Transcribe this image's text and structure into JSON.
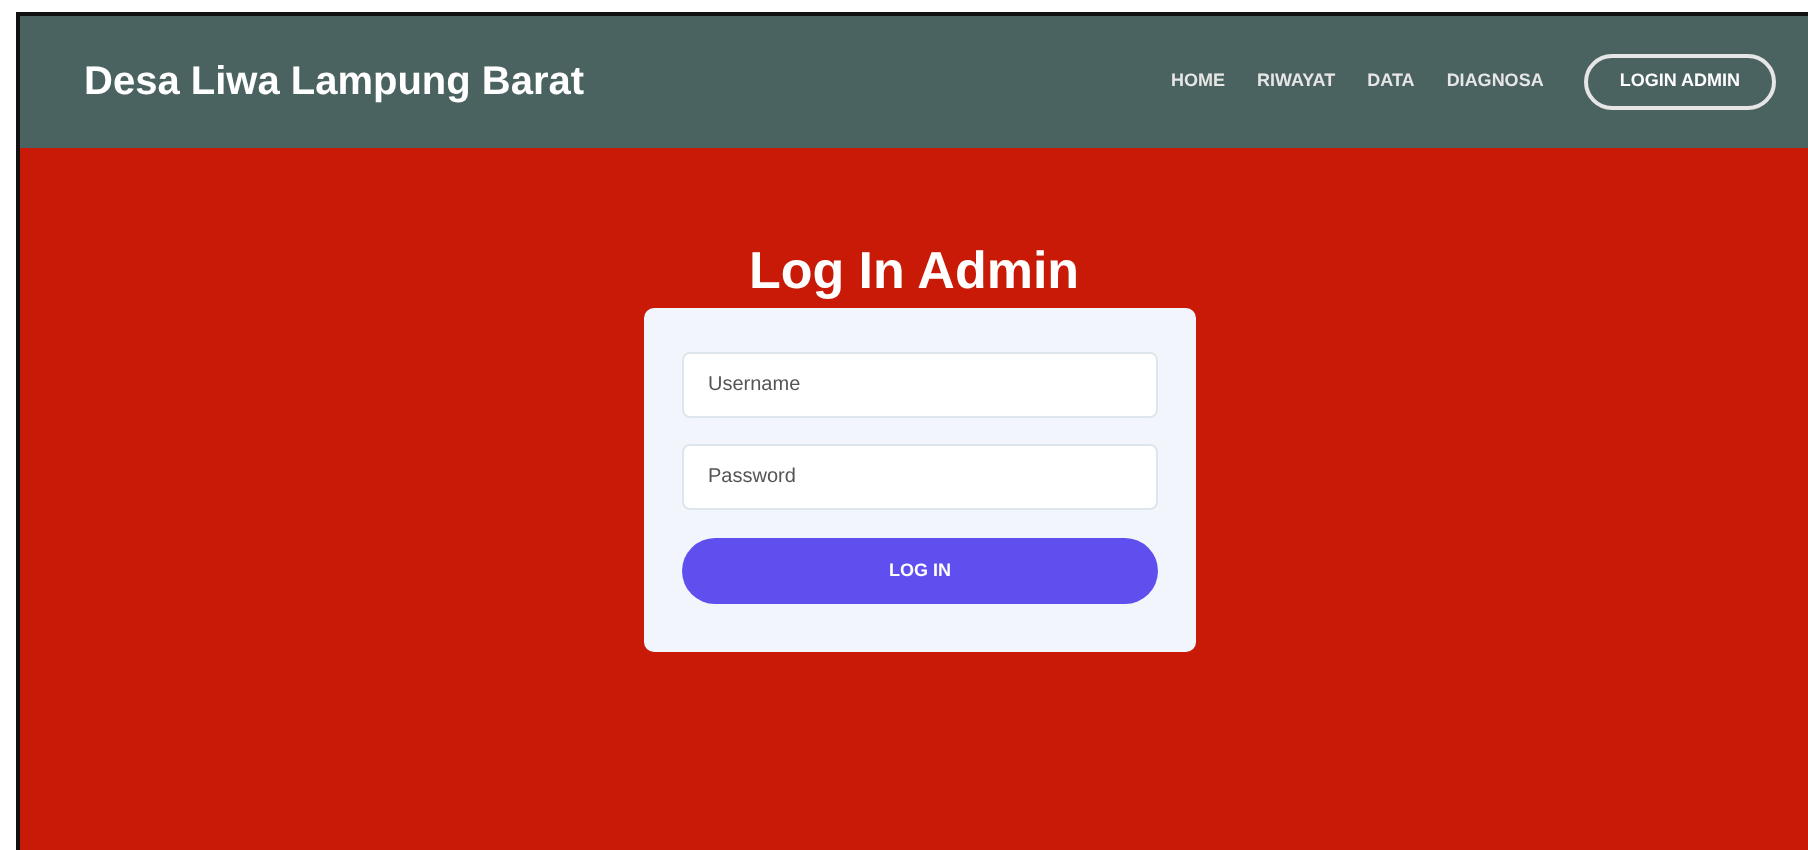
{
  "brand": "Desa Liwa Lampung Barat",
  "nav_links": [
    "HOME",
    "RIWAYAT",
    "DATA",
    "DIAGNOSA"
  ],
  "nav_button": "LOGIN ADMIN",
  "heading": "Log In Admin",
  "form": {
    "fields": [
      {
        "placeholder": "Username"
      },
      {
        "placeholder": "Password"
      }
    ],
    "submit": "LOG IN"
  }
}
